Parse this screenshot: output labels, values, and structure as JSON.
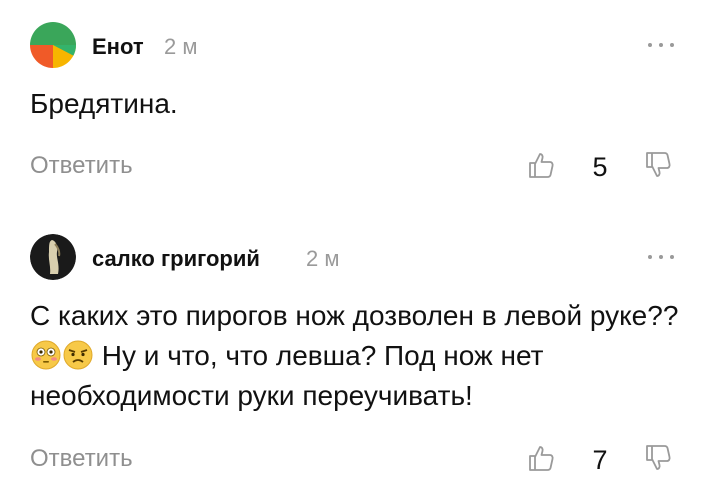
{
  "comments": [
    {
      "author": "Енот",
      "time": "2 м",
      "text": "Бредятина.",
      "reply_label": "Ответить",
      "likes": "5",
      "avatar_colors": [
        "#2fa84f",
        "#f05a28",
        "#f7b500",
        "#34b36b"
      ]
    },
    {
      "author": "салко григорий",
      "time": "2 м",
      "text_part1": "С каких это пирогов нож дозволен в левой руке??",
      "emoji": [
        "flushed-face-emoji",
        "angry-face-emoji"
      ],
      "text_part2": "Ну и что, что левша? Под нож нет необходимости руки переучивать!",
      "reply_label": "Ответить",
      "likes": "7"
    }
  ]
}
